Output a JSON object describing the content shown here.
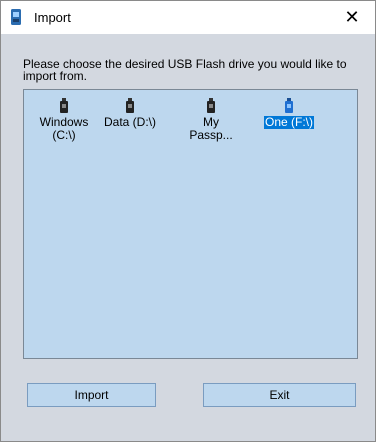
{
  "window": {
    "title": "Import",
    "close_glyph": "✕",
    "app_icon": "usb-drive-icon"
  },
  "prompt": "Please choose the desired USB Flash drive you would like to import from.",
  "drives": [
    {
      "label": "Windows\n(C:\\)",
      "icon": "usb-drive-icon",
      "selected": false
    },
    {
      "label": "Data (D:\\)",
      "icon": "usb-drive-icon",
      "selected": false
    },
    {
      "label": "My\nPassp...",
      "icon": "usb-drive-icon",
      "selected": false
    },
    {
      "label": "One (F:\\)",
      "icon": "usb-drive-icon",
      "selected": true
    }
  ],
  "buttons": {
    "import_label": "Import",
    "exit_label": "Exit"
  },
  "colors": {
    "list_background": "#bdd7ee",
    "selection": "#0078d7",
    "selected_icon": "#1f6fd1"
  }
}
